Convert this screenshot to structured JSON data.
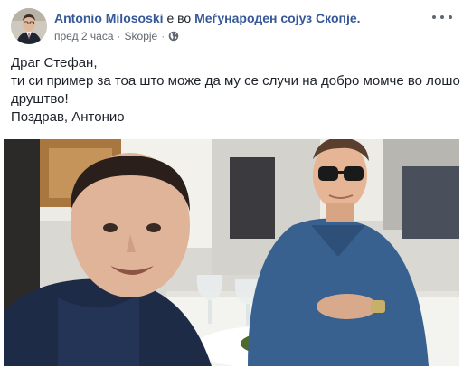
{
  "post": {
    "author": "Antonio Milososki",
    "connector": "е во",
    "page_name": "Меѓународен сојуз Скопје.",
    "time": "пред 2 часа",
    "separator": "·",
    "location": "Skopje",
    "text_lines": [
      "Драг Стефан,",
      "ти си пример за тоа што може да му се случи на добро момче во лошо",
      "друштво!",
      "Поздрав, Антонио"
    ]
  },
  "icons": {
    "privacy": "globe-icon",
    "menu": "more-options-icon"
  },
  "colors": {
    "link": "#365899",
    "text": "#1d2129",
    "meta": "#616770"
  }
}
